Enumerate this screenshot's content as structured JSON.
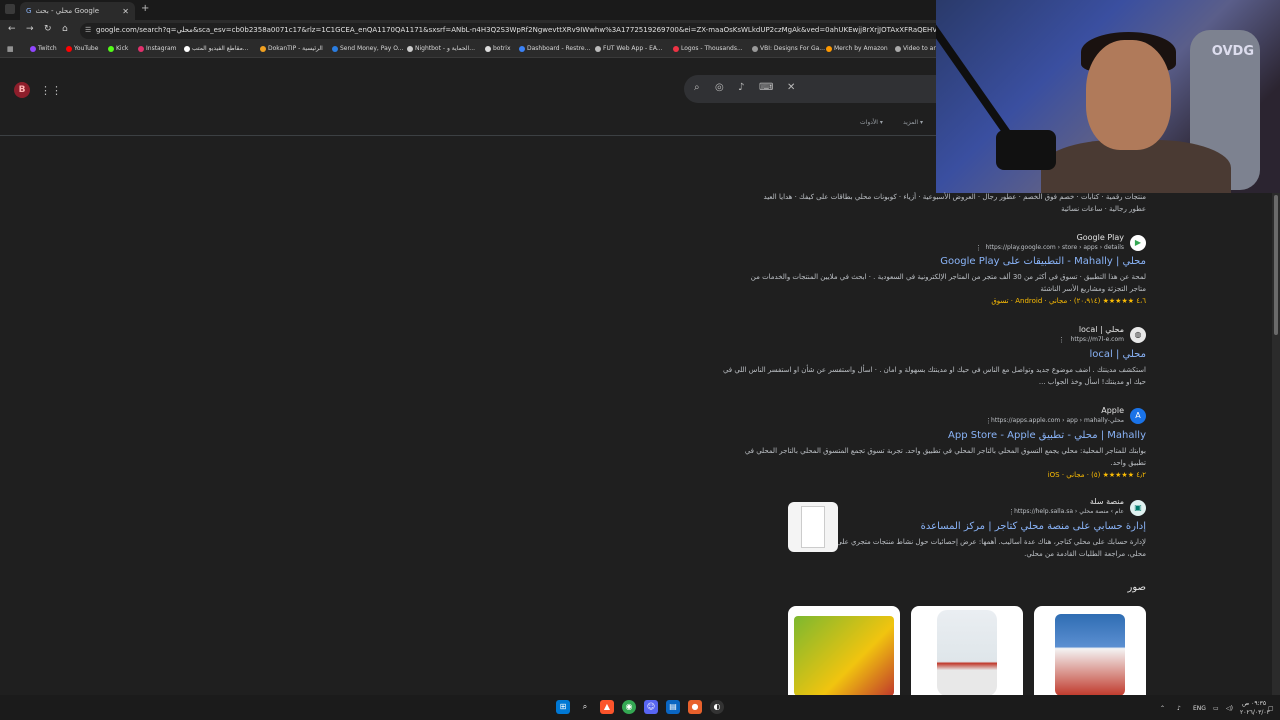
{
  "tab": {
    "title": "محلي - بحث Google"
  },
  "omnibox": {
    "url": "google.com/search?q=محلي&sca_esv=cb0b2358a0071c17&rlz=1C1GCEA_enQA1170QA1171&sxsrf=ANbL-n4H3Q2S3WpRf2NgwevttXRv9IWwhw%3A1772519269700&ei=ZX-maaOsKsWLkdUP2czMgAk&ved=0ahUKEwjj8rXrjJOTAxXFRaQEHVkmE5AQ4dUDCBE&uact=5&oq"
  },
  "bookmarks": [
    "Twitch",
    "YouTube",
    "Kick",
    "Instagram",
    "مقاطع الفيديو المتب...",
    "DokanTIP - الرئيسية",
    "Send Money, Pay O...",
    "Nightbot - الحماية و...",
    "botrix",
    "Dashboard - Restre...",
    "FUT Web App - EA...",
    "Logos - Thousands...",
    "VBI: Designs For Ga...",
    "Merch by Amazon",
    "Video to ani"
  ],
  "filters": {
    "more": "المزيد",
    "tools": "الأدوات"
  },
  "cam": {
    "brand": "OVDG"
  },
  "chips": {
    "line1": "منتجات رقمية · كتابات · خصم فوق الخصم · عطور رجال · العروض الأسبوعية · أزياء · كوبونات محلي بطاقات على كيفك · هدايا العيد",
    "line2": "عطور رجالية · ساعات نسائية"
  },
  "results": [
    {
      "site": "Google Play",
      "url": "https://play.google.com › store › apps › details",
      "title": "محلي | Mahally - التطبيقات على Google Play",
      "snippet1": "لمحة عن هذا التطبيق · تسوق في أكثر من 30 ألف متجر من المتاجر الإلكترونية في السعودية . · ابحث في ملايين المنتجات والخدمات من",
      "snippet2": "متاجر التجزئة ومشاريع الأسر الناشئة",
      "meta": "٤،٦ ★★★★★ (٢٠،٩١٤) · مجاني · Android · تسوق"
    },
    {
      "site": "محلي | local",
      "url": "https://m7l-e.com",
      "title": "محلي | local",
      "snippet1": "استكشف مدينتك . اضف موضوع جديد وتواصل مع الناس في حيك او مدينتك بسهولة و امان . · اسأل واستفسر عن شأن او استفسر الناس اللي في",
      "snippet2": "حيك او مدينتك! اسأل وخذ الجواب ..."
    },
    {
      "site": "Apple",
      "url": "https://apps.apple.com › app › mahally-محلي",
      "title": "Mahally | محلي - تطبيق App Store - Apple",
      "snippet1": "بوابتك للمتاجر المحلية: محلي يجمع التسوق المحلي بالتاجر المحلي في تطبيق واحد. تجربة تسوق تجمع المتسوق المحلي بالتاجر المحلي في",
      "snippet2": "تطبيق واحد.",
      "meta": "٤٫٢ ★★★★★ (٥) · مجاني · iOS"
    },
    {
      "site": "منصة سلة",
      "url": "https://help.salla.sa › عام › منصة محلي",
      "title": "إدارة حسابي على منصة محلي كتاجر | مركز المساعدة",
      "snippet1": "لإدارة حسابك على محلي كتاجر، هناك عدة أساليب. أهمها: عرض إحصائيات حول نشاط منتجات متجري على منصة",
      "snippet2": "محلي، مراجعة الطلبات القادمة من محلي."
    }
  ],
  "images": {
    "heading": "صور"
  },
  "tray": {
    "lang": "ENG",
    "time": "٠٩:٣٥ ص",
    "date": "٢٠٢٦/٠٣/٠٣"
  }
}
